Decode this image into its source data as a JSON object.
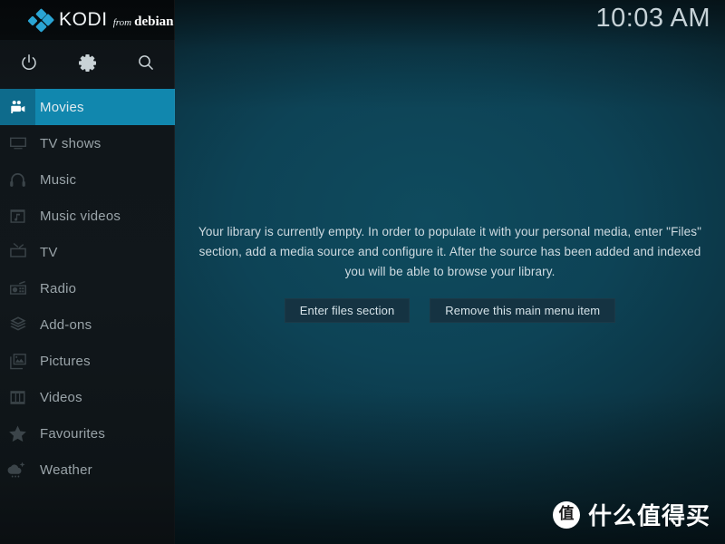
{
  "app": {
    "logo": {
      "name": "KODI",
      "from": "from",
      "distro": "debian"
    },
    "clock": "10:03 AM"
  },
  "toolbar": {
    "items": [
      {
        "name": "power-icon",
        "label": "Power"
      },
      {
        "name": "gear-icon",
        "label": "Settings"
      },
      {
        "name": "search-icon",
        "label": "Search"
      }
    ]
  },
  "sidebar": {
    "items": [
      {
        "label": "Movies",
        "icon": "movie-camera-icon",
        "selected": true
      },
      {
        "label": "TV shows",
        "icon": "television-icon",
        "selected": false
      },
      {
        "label": "Music",
        "icon": "headphones-icon",
        "selected": false
      },
      {
        "label": "Music videos",
        "icon": "film-note-icon",
        "selected": false
      },
      {
        "label": "TV",
        "icon": "tv-antenna-icon",
        "selected": false
      },
      {
        "label": "Radio",
        "icon": "radio-icon",
        "selected": false
      },
      {
        "label": "Add-ons",
        "icon": "open-box-icon",
        "selected": false
      },
      {
        "label": "Pictures",
        "icon": "photos-icon",
        "selected": false
      },
      {
        "label": "Videos",
        "icon": "film-strip-icon",
        "selected": false
      },
      {
        "label": "Favourites",
        "icon": "star-icon",
        "selected": false
      },
      {
        "label": "Weather",
        "icon": "cloud-sun-rain-icon",
        "selected": false
      }
    ]
  },
  "main": {
    "empty_message": "Your library is currently empty. In order to populate it with your personal media, enter \"Files\" section, add a media source and configure it. After the source has been added and indexed you will be able to browse your library.",
    "buttons": [
      {
        "label": "Enter files section"
      },
      {
        "label": "Remove this main menu item"
      }
    ]
  },
  "watermark": {
    "badge": "值",
    "text": "什么值得买"
  },
  "colors": {
    "accent": "#1187ae",
    "accent_dark": "#0e6b8c",
    "logo_blue": "#2aa5d4",
    "sidebar_bg": "#11171b",
    "main_bg": "#0d4356",
    "button_bg": "#153342"
  }
}
